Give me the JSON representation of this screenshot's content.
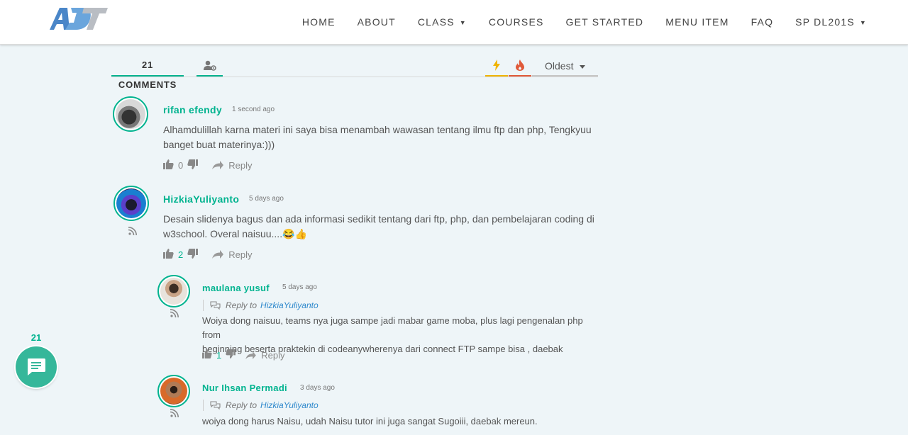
{
  "colors": {
    "accent": "#00b38f",
    "link": "#2f89cc",
    "hot": "#f0b400",
    "fire": "#e05a3a",
    "bubble": "#35b79a"
  },
  "nav": {
    "items": [
      {
        "label": "HOME",
        "dropdown": false
      },
      {
        "label": "ABOUT",
        "dropdown": false
      },
      {
        "label": "CLASS",
        "dropdown": true
      },
      {
        "label": "COURSES",
        "dropdown": false
      },
      {
        "label": "GET STARTED",
        "dropdown": false
      },
      {
        "label": "MENU ITEM",
        "dropdown": false
      },
      {
        "label": "FAQ",
        "dropdown": false
      },
      {
        "label": "SP DL201S",
        "dropdown": true
      }
    ]
  },
  "comments_header": {
    "count_label": "21 COMMENTS",
    "sort_label": "Oldest"
  },
  "comments": [
    {
      "author": "rifan efendy",
      "time": "1 second ago",
      "text_line1": "Alhamdulillah karna materi ini saya bisa menambah wawasan tentang ilmu ftp dan php, Tengkyuu",
      "text_line2": "banget buat materinya:)))",
      "votes": "0",
      "reply_label": "Reply"
    },
    {
      "author": "HizkiaYuliyanto",
      "time": "5 days ago",
      "text_line1": "Desain slidenya bagus dan ada informasi sedikit tentang dari ftp, php, dan pembelajaran coding di",
      "text_line2": "w3school. Overal naisuu....😂👍",
      "votes": "2",
      "reply_label": "Reply"
    },
    {
      "author": "maulana yusuf",
      "time": "5 days ago",
      "reply_to_label": "Reply to",
      "reply_to_name": "HizkiaYuliyanto",
      "text_line1": "Woiya dong naisuu, teams nya juga sampe jadi mabar game moba, plus lagi pengenalan php from",
      "text_line2": "beginning beserta praktekin di codeanywherenya dari connect FTP sampe bisa , daebak",
      "votes": "1",
      "reply_label": "Reply"
    },
    {
      "author": "Nur Ihsan Permadi",
      "time": "3 days ago",
      "reply_to_label": "Reply to",
      "reply_to_name": "HizkiaYuliyanto",
      "text_line1": "woiya dong harus Naisu, udah Naisu tutor ini juga sangat Sugoiii, daebak mereun."
    }
  ],
  "bubble": {
    "count": "21"
  }
}
